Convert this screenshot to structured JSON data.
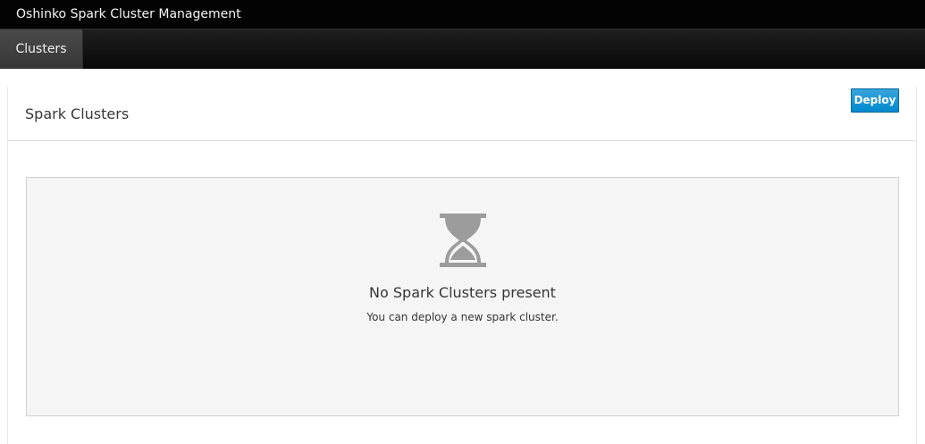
{
  "header": {
    "title": "Oshinko Spark Cluster Management"
  },
  "nav": {
    "tabs": [
      {
        "label": "Clusters",
        "active": true
      }
    ]
  },
  "main": {
    "title": "Spark Clusters",
    "deploy_label": "Deploy"
  },
  "empty_state": {
    "icon": "hourglass-icon",
    "title": "No Spark Clusters present",
    "text": "You can deploy a new spark cluster."
  },
  "colors": {
    "header_bg": "#030303",
    "nav_active": "#3f3f3f",
    "primary_button": "#0088ce",
    "empty_bg": "#f5f5f5",
    "icon": "#9c9c9c"
  }
}
